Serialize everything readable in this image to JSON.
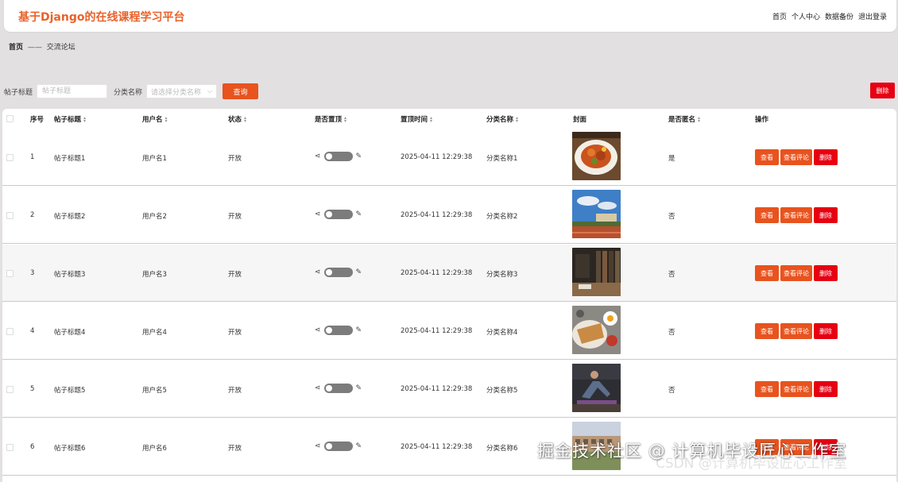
{
  "header": {
    "title": "基于Django的在线课程学习平台",
    "nav": [
      "首页",
      "个人中心",
      "数据备份",
      "退出登录"
    ]
  },
  "breadcrumb": {
    "home": "首页",
    "separator": "——",
    "current": "交流论坛"
  },
  "search": {
    "title_label": "帖子标题",
    "title_placeholder": "帖子标题",
    "category_label": "分类名称",
    "category_placeholder": "请选择分类名称",
    "query_label": "查询",
    "delete_label": "删除"
  },
  "table": {
    "columns": [
      "序号",
      "帖子标题",
      "用户名",
      "状态",
      "是否置顶",
      "置顶时间",
      "分类名称",
      "封面",
      "是否匿名",
      "操作"
    ],
    "rows": [
      {
        "index": "1",
        "title": "帖子标题1",
        "user": "用户名1",
        "status": "开放",
        "top_time": "2025-04-11 12:29:38",
        "category": "分类名称1",
        "anonymous": "是",
        "cover": "food-plate"
      },
      {
        "index": "2",
        "title": "帖子标题2",
        "user": "用户名2",
        "status": "开放",
        "top_time": "2025-04-11 12:29:38",
        "category": "分类名称2",
        "anonymous": "否",
        "cover": "campus-sky"
      },
      {
        "index": "3",
        "title": "帖子标题3",
        "user": "用户名3",
        "status": "开放",
        "top_time": "2025-04-11 12:29:38",
        "category": "分类名称3",
        "anonymous": "否",
        "cover": "library"
      },
      {
        "index": "4",
        "title": "帖子标题4",
        "user": "用户名4",
        "status": "开放",
        "top_time": "2025-04-11 12:29:38",
        "category": "分类名称4",
        "anonymous": "否",
        "cover": "breakfast"
      },
      {
        "index": "5",
        "title": "帖子标题5",
        "user": "用户名5",
        "status": "开放",
        "top_time": "2025-04-11 12:29:38",
        "category": "分类名称5",
        "anonymous": "否",
        "cover": "yoga"
      },
      {
        "index": "6",
        "title": "帖子标题6",
        "user": "用户名6",
        "status": "开放",
        "top_time": "2025-04-11 12:29:38",
        "category": "分类名称6",
        "anonymous": "",
        "cover": "building"
      }
    ],
    "actions": {
      "view": "查看",
      "comments": "查看评论",
      "delete": "删除"
    }
  },
  "watermark": {
    "text": "掘金技术社区 @ 计算机毕设匠心工作室",
    "csdn": "CSDN @计算机毕设匠心工作室"
  },
  "colors": {
    "accent": "#e8531e",
    "danger": "#e60012",
    "title": "#e8622a"
  }
}
